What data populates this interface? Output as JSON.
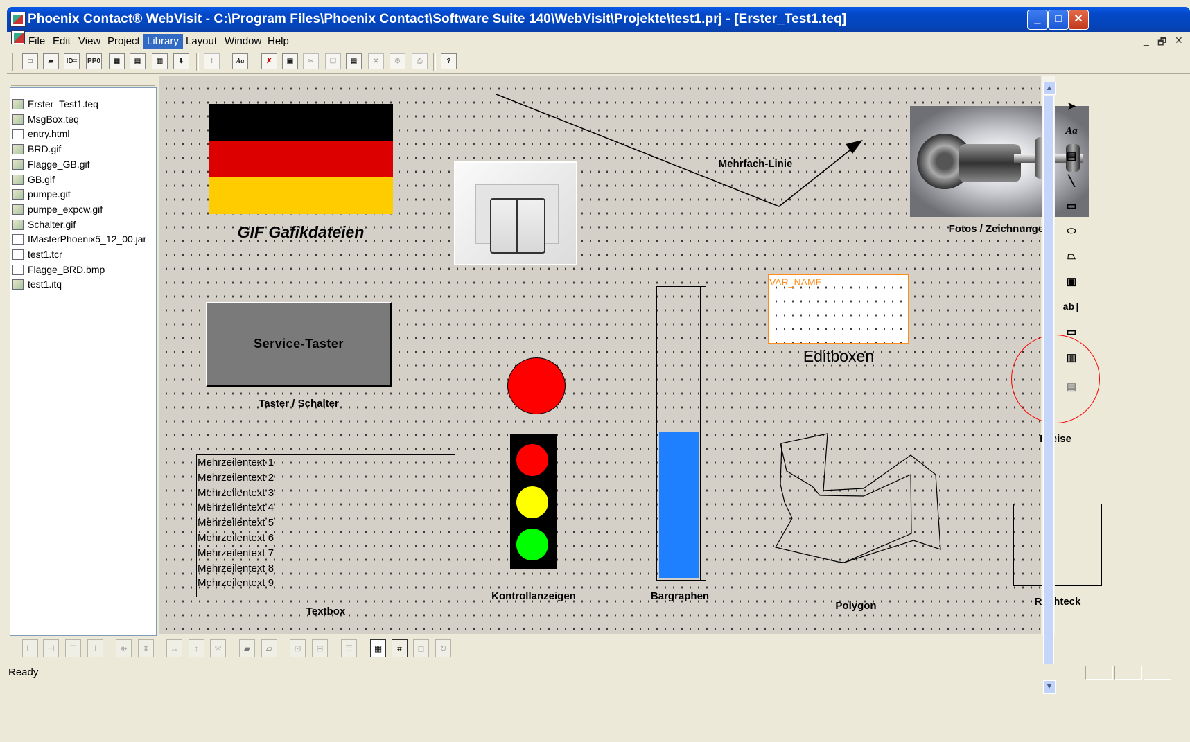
{
  "window": {
    "title": "Phoenix Contact®  WebVisit - C:\\Program Files\\Phoenix Contact\\Software Suite 140\\WebVisit\\Projekte\\test1.prj - [Erster_Test1.teq]",
    "minimize": "_",
    "maximize": "□",
    "close": "✕"
  },
  "menu": [
    "File",
    "Edit",
    "View",
    "Project",
    "Library",
    "Layout",
    "Window",
    "Help"
  ],
  "menu_active": "Library",
  "mdi_controls": {
    "minimize": "_",
    "restore": "🗗",
    "close": "✕"
  },
  "toolbar": {
    "id_btn": "ID=",
    "ppo_btn": "PP0",
    "exclaim_btn": "!",
    "font_btn": "Aa",
    "help_btn": "?"
  },
  "tree": {
    "close": "×",
    "items": [
      "Erster_Test1.teq",
      "MsgBox.teq",
      "entry.html",
      "BRD.gif",
      "Flagge_GB.gif",
      "GB.gif",
      "pumpe.gif",
      "pumpe_expcw.gif",
      "Schalter.gif",
      "IMasterPhoenix5_12_00.jar",
      "test1.tcr",
      "Flagge_BRD.bmp",
      "test1.itq"
    ]
  },
  "canvas": {
    "gif_caption": "GIF Gafikdateien",
    "mehrfach_linie": "Mehrfach-Linie",
    "fotos_caption": "Fotos / Zeichnungen",
    "service_taster_label": "Service-Taster",
    "taster_caption": "Taster / Schalter",
    "editbox_var": "VAR_NAME",
    "editbox_caption": "Editboxen",
    "kreise_caption": "Kreise",
    "textbox_lines": [
      "Mehrzeilentext 1",
      "Mehrzeilentext 2",
      "Mehrzeilentext 3",
      "Mehrzeilentext 4",
      "Mehrzeilentext 5",
      "Mehrzeilentext 6",
      "Mehrzeilentext 7",
      "Mehrzeilentext 8",
      "Mehrzeilentext 9"
    ],
    "textbox_caption": "Textbox",
    "kontroll_caption": "Kontrollanzeigen",
    "bargraph_caption": "Bargraphen",
    "bargraph_level": 0.5,
    "polygon_caption": "Polygon",
    "rechteck_caption": "Rechteck",
    "colors": {
      "flag_black": "#000000",
      "flag_red": "#dd0000",
      "flag_gold": "#ffcc00",
      "lamp_red": "#ff0000",
      "lamp_yellow": "#ffff00",
      "lamp_green": "#00ff00",
      "bar_fill": "#1e7fff",
      "editbox_border": "#ff8c1a"
    }
  },
  "right_tools": {
    "text": "Aa",
    "editbox": "ab|"
  },
  "statusbar": {
    "text": "Ready"
  }
}
